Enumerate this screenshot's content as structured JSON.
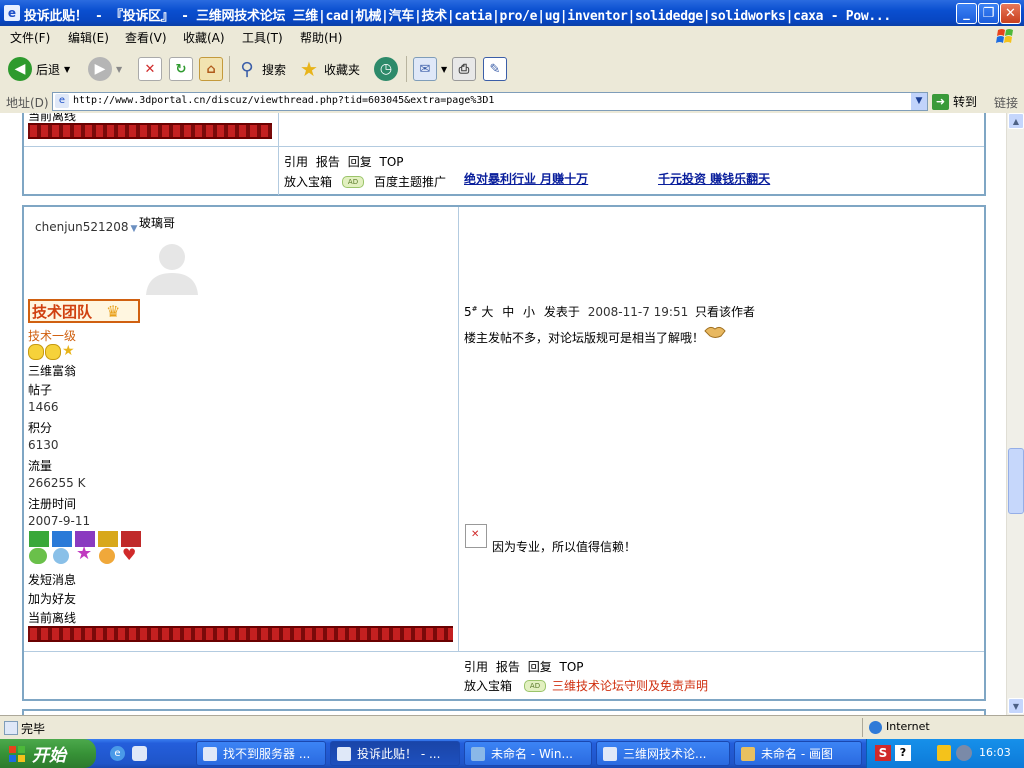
{
  "window": {
    "title": "投诉此贴！ - 『投诉区』 - 三维网技术论坛 三维|cad|机械|汽车|技术|catia|pro/e|ug|inventor|solidedge|solidworks|caxa - Pow..."
  },
  "menu": [
    "文件(F)",
    "编辑(E)",
    "查看(V)",
    "收藏(A)",
    "工具(T)",
    "帮助(H)"
  ],
  "toolbar": {
    "back": "后退",
    "search": "搜索",
    "favorites": "收藏夹"
  },
  "address": {
    "label": "地址(D)",
    "url": "http://www.3dportal.cn/discuz/viewthread.php?tid=603045&extra=page%3D1",
    "go": "转到",
    "links": "链接"
  },
  "post_top": {
    "partial_status": "当前离线",
    "actions": [
      "引用",
      "报告",
      "回复",
      "TOP"
    ],
    "box": "放入宝箱",
    "ad_badge": "AD",
    "ad_text": "百度主题推广",
    "link1": "绝对暴利行业  月赚十万",
    "link2": "千元投资 赚钱乐翻天"
  },
  "post": {
    "username": "chenjun521208",
    "title_nick": "玻璃哥",
    "team_badge": "技术团队",
    "level": "技术一级",
    "rank": "三维富翁",
    "stats": [
      {
        "label": "帖子",
        "value": "1466"
      },
      {
        "label": "积分",
        "value": "6130"
      },
      {
        "label": "流量",
        "value": "266255 K"
      },
      {
        "label": "注册时间",
        "value": "2007-9-11"
      }
    ],
    "pm": "发短消息",
    "add_friend": "加为好友",
    "status": "当前离线",
    "floor_num": "5",
    "floor_sup": "#",
    "font_sizes": [
      "大",
      "中",
      "小"
    ],
    "posted_at_label": "发表于",
    "posted_at": "2008-11-7 19:51",
    "only_author": "只看该作者",
    "message": "楼主发帖不多，对论坛版规可是相当了解哦！",
    "signature": "因为专业，所以值得信赖！",
    "actions": [
      "引用",
      "报告",
      "回复",
      "TOP"
    ],
    "box": "放入宝箱",
    "ad_badge": "AD",
    "ad_link": "三维技术论坛守则及免责声明"
  },
  "status": {
    "text": "完毕",
    "zone": "Internet"
  },
  "taskbar": {
    "start": "开始",
    "tasks": [
      "找不到服务器 ...",
      "投诉此贴！ - ...",
      "未命名 - Win...",
      "三维网技术论...",
      "未命名 - 画图"
    ],
    "clock": "16:03"
  }
}
